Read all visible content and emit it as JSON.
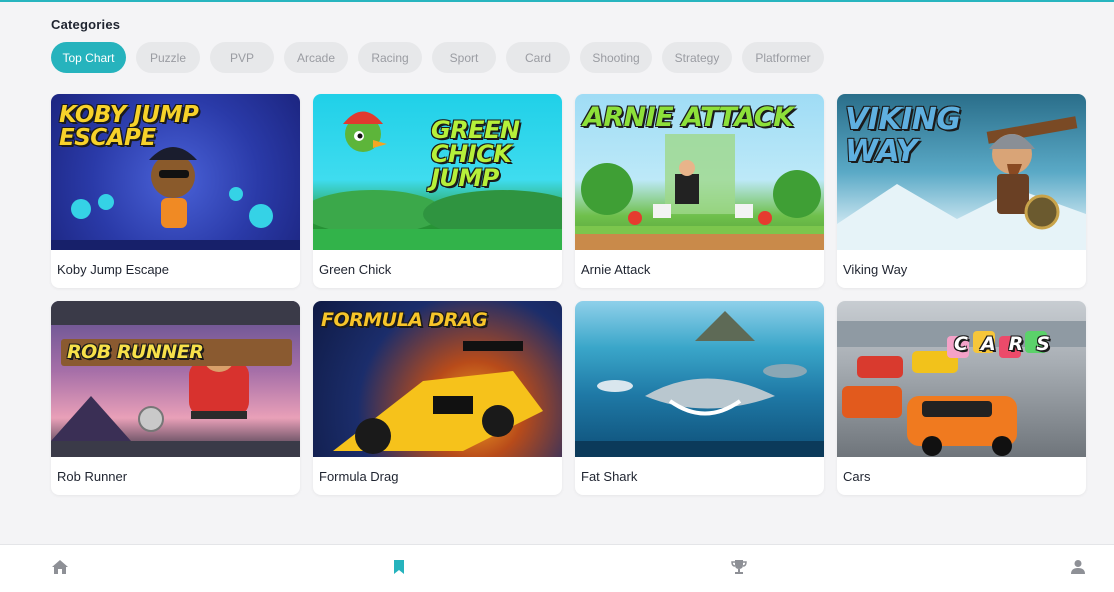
{
  "categories": {
    "title": "Categories",
    "chips": [
      {
        "label": "Top Chart",
        "active": true
      },
      {
        "label": "Puzzle",
        "active": false
      },
      {
        "label": "PVP",
        "active": false
      },
      {
        "label": "Arcade",
        "active": false
      },
      {
        "label": "Racing",
        "active": false
      },
      {
        "label": "Sport",
        "active": false
      },
      {
        "label": "Card",
        "active": false
      },
      {
        "label": "Shooting",
        "active": false
      },
      {
        "label": "Strategy",
        "active": false
      },
      {
        "label": "Platformer",
        "active": false
      }
    ]
  },
  "games": [
    {
      "name": "Koby Jump Escape",
      "art_title": "KOBY JUMP ESCAPE"
    },
    {
      "name": "Green Chick",
      "art_title": "GREEN CHICK JUMP"
    },
    {
      "name": "Arnie Attack",
      "art_title": "ARNIE ATTACK"
    },
    {
      "name": "Viking Way",
      "art_title": "VIKING WAY"
    },
    {
      "name": "Rob Runner",
      "art_title": "ROB RUNNER"
    },
    {
      "name": "Formula Drag",
      "art_title": "FORMULA DRAG"
    },
    {
      "name": "Fat Shark",
      "art_title": ""
    },
    {
      "name": "Cars",
      "art_title": "CARS"
    }
  ],
  "nav": {
    "items": [
      {
        "icon": "home-icon",
        "active": false
      },
      {
        "icon": "bookmark-icon",
        "active": true
      },
      {
        "icon": "trophy-icon",
        "active": false
      },
      {
        "icon": "user-icon",
        "active": false
      }
    ]
  },
  "colors": {
    "accent": "#26b3bd",
    "chip_bg": "#e7e8ea",
    "chip_text": "#9a9ca2",
    "background": "#f4f4f6",
    "icon_inactive": "#8e9096"
  }
}
